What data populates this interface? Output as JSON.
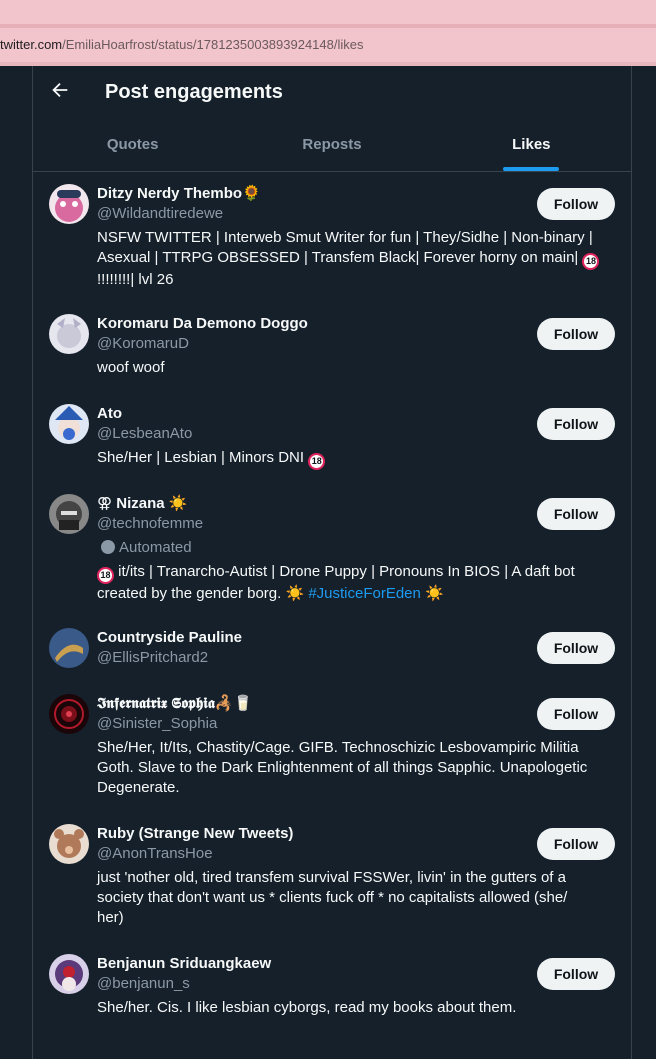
{
  "browser": {
    "url_host": "twitter.com",
    "url_path": "/EmiliaHoarfrost/status/1781235003893924148/likes"
  },
  "header": {
    "title": "Post engagements"
  },
  "tabs": [
    {
      "label": "Quotes",
      "active": false
    },
    {
      "label": "Reposts",
      "active": false
    },
    {
      "label": "Likes",
      "active": true
    }
  ],
  "follow_label": "Follow",
  "users": [
    {
      "name": "Ditzy Nerdy Thembo🌻",
      "handle": "@Wildandtiredewe",
      "bio_line1": "NSFW TWITTER | Interweb Smut Writer for fun | They/Sidhe | Non-binary |",
      "bio_line2": "Asexual | TTRPG OBSESSED | Transfem Black| Forever horny on main|",
      "bio_line2_badge": "18",
      "bio_line3": "!!!!!!!!| lvl 26",
      "avatar_color": "#d86aa0"
    },
    {
      "name": "Koromaru Da Demono Doggo",
      "handle": "@KoromaruD",
      "bio": "woof woof",
      "avatar_color": "#c9c9d8"
    },
    {
      "name": "Ato",
      "handle": "@LesbeanAto",
      "bio": "She/Her | Lesbian | Minors DNI",
      "bio_badge": "18",
      "avatar_color": "#2a5cb3"
    },
    {
      "name": "⚢ Nizana ☀️",
      "handle": "@technofemme",
      "automated_label": "Automated",
      "bio_badge": "18",
      "bio_line1": " it/its | Tranarcho-Autist | Drone Puppy | Pronouns In BIOS | A daft bot",
      "bio_line2": "created by the gender borg. ☀️",
      "hashtag": "#JusticeForEden",
      "bio_line2_end": " ☀️",
      "avatar_color": "#444444"
    },
    {
      "name": "Countryside Pauline",
      "handle": "@EllisPritchard2",
      "avatar_color": "#3a5a8a"
    },
    {
      "name": "𝕴𝖓𝖋𝖊𝖗𝖓𝖆𝖙𝖗𝖎𝖝 𝕾𝖔𝖕𝖍𝖎𝖆🦂🥛",
      "handle": "@Sinister_Sophia",
      "bio_line1": "She/Her, It/Its, Chastity/Cage. GIFB. Technoschizic Lesbovampiric Militia",
      "bio_line2": "Goth. Slave to the Dark Enlightenment of all things Sapphic. Unapologetic",
      "bio_line3": "Degenerate.",
      "avatar_color": "#7a0f1a"
    },
    {
      "name": "Ruby (Strange New Tweets)",
      "handle": "@AnonTransHoe",
      "bio_line1": "just 'nother old, tired transfem survival FSSWer, livin' in the gutters of a",
      "bio_line2": "society that don't want us * clients fuck off * no capitalists allowed (she/",
      "bio_line3": "her)",
      "avatar_color": "#b07a5a"
    },
    {
      "name": "Benjanun Sriduangkaew",
      "handle": "@benjanun_s",
      "bio": "She/her. Cis. I like lesbian cyborgs, read my books about them.",
      "avatar_color": "#5a3a7a"
    }
  ]
}
